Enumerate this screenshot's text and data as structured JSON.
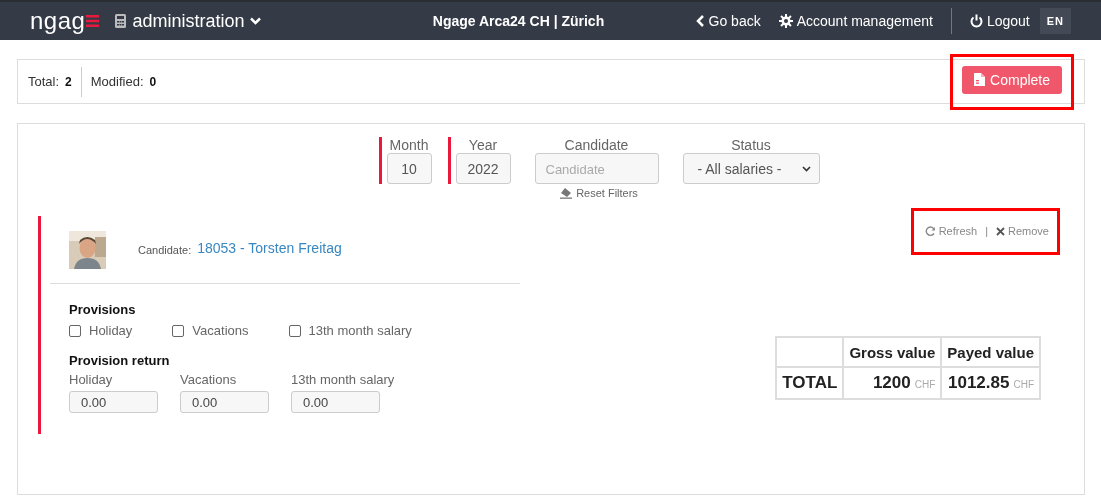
{
  "header": {
    "logo": "ngag",
    "module": "administration",
    "company": "Ngage Arca24 CH | Zürich",
    "links": [
      {
        "kind": "back",
        "label": "Go back"
      },
      {
        "kind": "settings",
        "label": "Account management"
      },
      {
        "kind": "logout",
        "label": "Logout"
      }
    ],
    "language": "EN"
  },
  "summary": {
    "stats": [
      {
        "label": "Total:",
        "value": "2"
      },
      {
        "label": "Modified:",
        "value": "0"
      }
    ],
    "complete_button": {
      "label": "Complete",
      "highlighted": true
    }
  },
  "filters": {
    "fields": [
      {
        "kind": "input",
        "label": "Month",
        "value": "10",
        "required": true
      },
      {
        "kind": "input",
        "label": "Year",
        "value": "2022",
        "required": true
      },
      {
        "kind": "input",
        "label": "Candidate",
        "placeholder": "Candidate",
        "required": false
      },
      {
        "kind": "select",
        "label": "Status",
        "value": "- All salaries -",
        "required": false
      }
    ],
    "reset": "Reset Filters"
  },
  "entry": {
    "candidate_label": "Candidate:",
    "candidate": "18053 - Torsten Freitag",
    "actions": {
      "highlighted": true,
      "separator": "|",
      "items": [
        {
          "kind": "refresh",
          "label": "Refresh"
        },
        {
          "kind": "remove",
          "label": "Remove"
        }
      ]
    },
    "provisions": {
      "title": "Provisions",
      "options": [
        {
          "label": "Holiday",
          "checked": false
        },
        {
          "label": "Vacations",
          "checked": false
        },
        {
          "label": "13th month salary",
          "checked": false
        }
      ]
    },
    "provision_return": {
      "title": "Provision return",
      "fields": [
        {
          "label": "Holiday",
          "value": "0.00"
        },
        {
          "label": "Vacations",
          "value": "0.00"
        },
        {
          "label": "13th month salary",
          "value": "0.00"
        }
      ]
    },
    "totals": {
      "columns": [
        "Gross value",
        "Payed value"
      ],
      "row_label": "TOTAL",
      "values": [
        {
          "amount": "1200",
          "currency": "CHF"
        },
        {
          "amount": "1012.85",
          "currency": "CHF"
        }
      ]
    }
  }
}
